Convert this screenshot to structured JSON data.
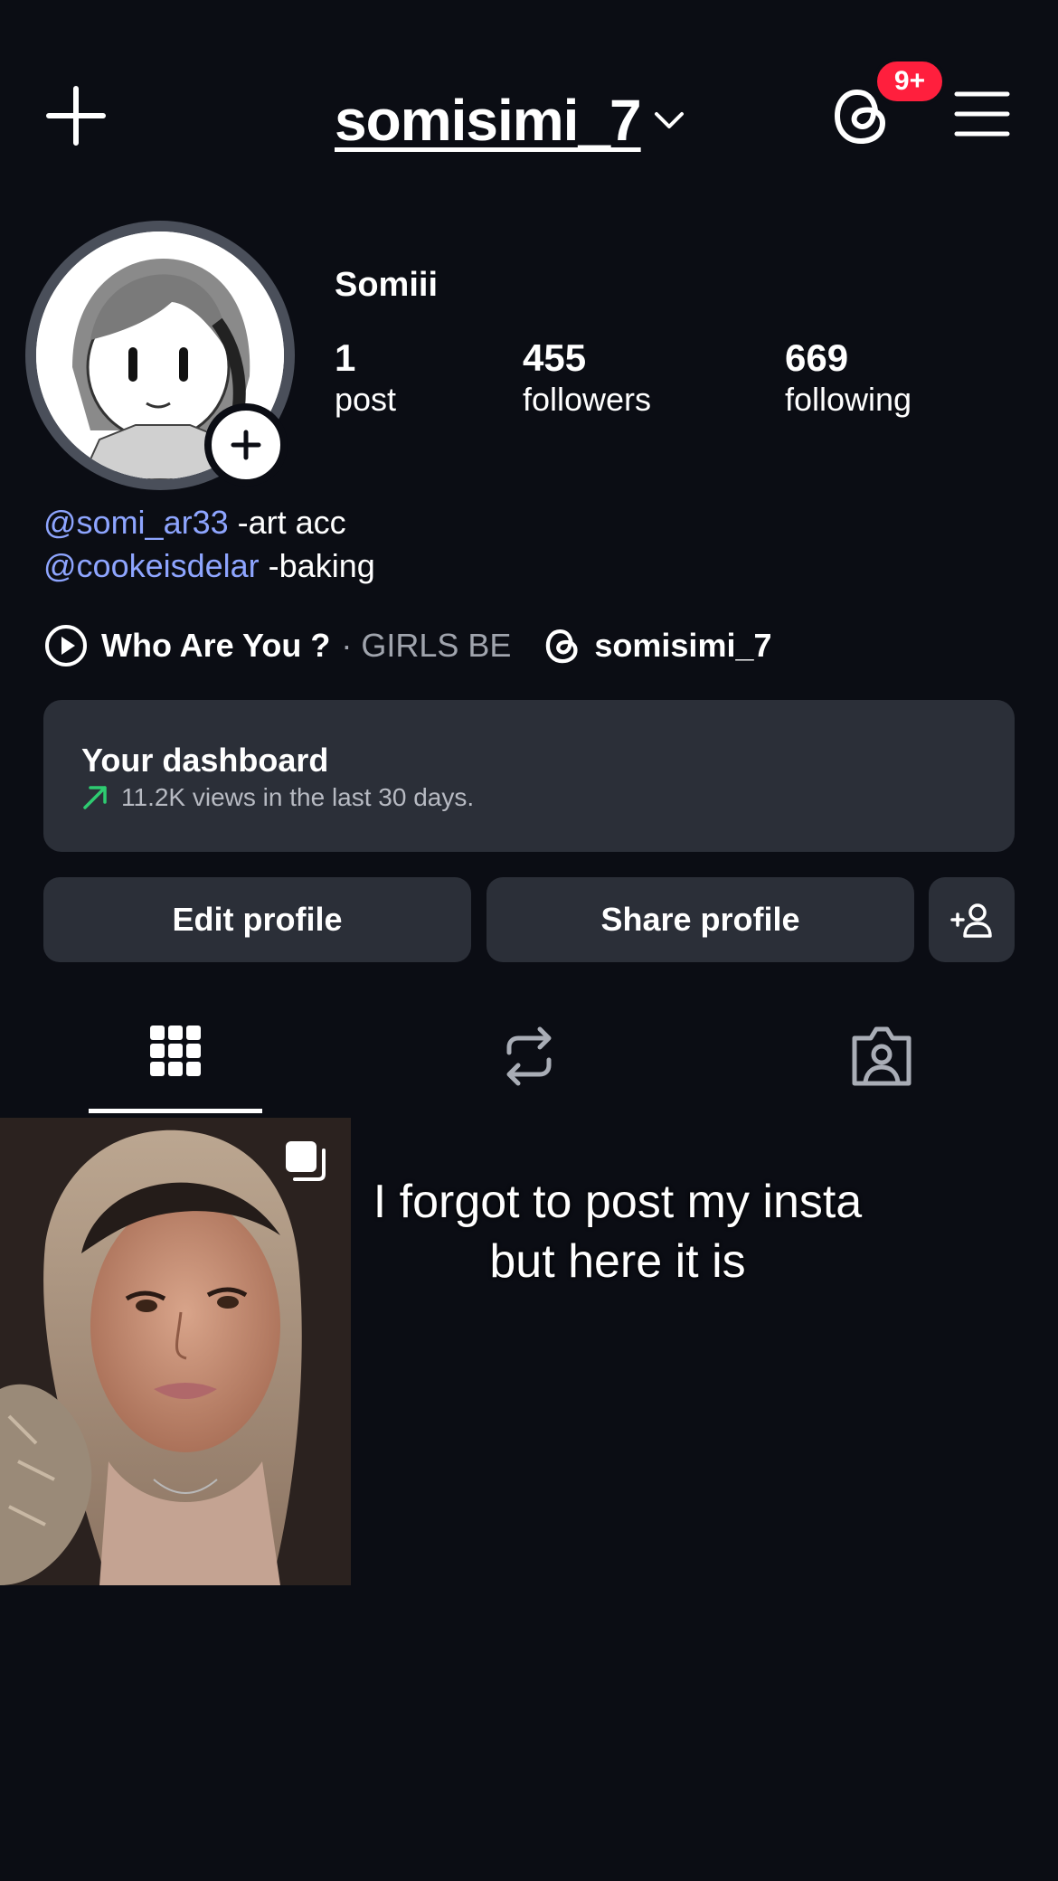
{
  "header": {
    "username": "somisimi_7",
    "notification_badge": "9+",
    "icons": [
      "plus-icon",
      "chevron-down-icon",
      "threads-icon",
      "hamburger-menu-icon"
    ]
  },
  "profile": {
    "display_name": "Somiii",
    "stats": [
      {
        "value": "1",
        "label": "post"
      },
      {
        "value": "455",
        "label": "followers"
      },
      {
        "value": "669",
        "label": "following"
      }
    ],
    "bio": [
      {
        "mention": "@somi_ar33",
        "text": " -art acc"
      },
      {
        "mention": "@cookeisdelar",
        "text": " -baking"
      }
    ],
    "music": {
      "title": "Who Are You ?",
      "artist": "· GIRLS BE"
    },
    "threads_handle": "somisimi_7"
  },
  "dashboard": {
    "title": "Your dashboard",
    "subtitle": "11.2K views in the last 30 days.",
    "trend_color": "#2ecc71"
  },
  "buttons": {
    "edit": "Edit profile",
    "share": "Share profile"
  },
  "tabs": [
    {
      "name": "posts-grid",
      "icon": "grid-icon",
      "active": true
    },
    {
      "name": "reposts",
      "icon": "repost-icon",
      "active": false
    },
    {
      "name": "tagged",
      "icon": "tagged-person-icon",
      "active": false
    }
  ],
  "overlay_caption": "I forgot to post my insta but here it is",
  "colors": {
    "background": "#0b0d14",
    "surface": "#2b2f38",
    "mention": "#8ea5ff",
    "badge": "#ff1f3d"
  }
}
